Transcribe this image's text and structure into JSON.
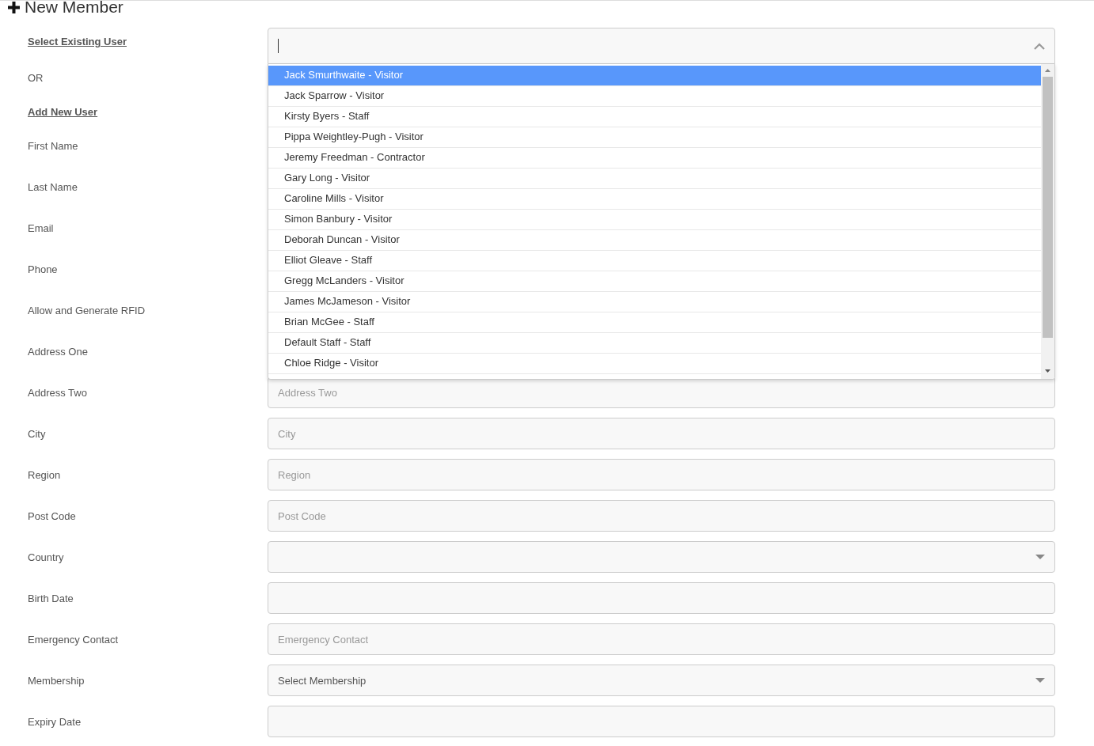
{
  "header": {
    "title": "New Member"
  },
  "intro": [
    {
      "kind": "link",
      "label": "Select Existing User"
    },
    {
      "kind": "text",
      "label": "OR"
    },
    {
      "kind": "link",
      "label": "Add New User"
    }
  ],
  "user_select": {
    "open": true,
    "options": [
      {
        "label": "Jack Smurthwaite - Visitor",
        "selected": true
      },
      {
        "label": "Jack Sparrow - Visitor",
        "selected": false
      },
      {
        "label": "Kirsty Byers - Staff",
        "selected": false
      },
      {
        "label": "Pippa Weightley-Pugh - Visitor",
        "selected": false
      },
      {
        "label": "Jeremy Freedman - Contractor",
        "selected": false
      },
      {
        "label": "Gary Long - Visitor",
        "selected": false
      },
      {
        "label": "Caroline Mills - Visitor",
        "selected": false
      },
      {
        "label": "Simon Banbury - Visitor",
        "selected": false
      },
      {
        "label": "Deborah Duncan - Visitor",
        "selected": false
      },
      {
        "label": "Elliot Gleave - Staff",
        "selected": false
      },
      {
        "label": "Gregg McLanders - Visitor",
        "selected": false
      },
      {
        "label": "James McJameson - Visitor",
        "selected": false
      },
      {
        "label": "Brian McGee - Staff",
        "selected": false
      },
      {
        "label": "Default Staff - Staff",
        "selected": false
      },
      {
        "label": "Chloe Ridge - Visitor",
        "selected": false
      }
    ]
  },
  "fields": [
    {
      "label": "First Name"
    },
    {
      "label": "Last Name"
    },
    {
      "label": "Email"
    },
    {
      "label": "Phone"
    },
    {
      "label": "Allow and Generate RFID"
    },
    {
      "label": "Address One"
    },
    {
      "label": "Address Two",
      "field": {
        "kind": "input",
        "placeholder": "Address Two"
      }
    },
    {
      "label": "City",
      "field": {
        "kind": "input",
        "placeholder": "City"
      }
    },
    {
      "label": "Region",
      "field": {
        "kind": "input",
        "placeholder": "Region"
      }
    },
    {
      "label": "Post Code",
      "field": {
        "kind": "input",
        "placeholder": "Post Code"
      }
    },
    {
      "label": "Country",
      "field": {
        "kind": "select"
      }
    },
    {
      "label": "Birth Date",
      "field": {
        "kind": "input"
      }
    },
    {
      "label": "Emergency Contact",
      "field": {
        "kind": "input",
        "placeholder": "Emergency Contact"
      }
    },
    {
      "label": "Membership",
      "field": {
        "kind": "select",
        "value": "Select Membership"
      }
    },
    {
      "label": "Expiry Date",
      "field": {
        "kind": "input"
      }
    }
  ]
}
